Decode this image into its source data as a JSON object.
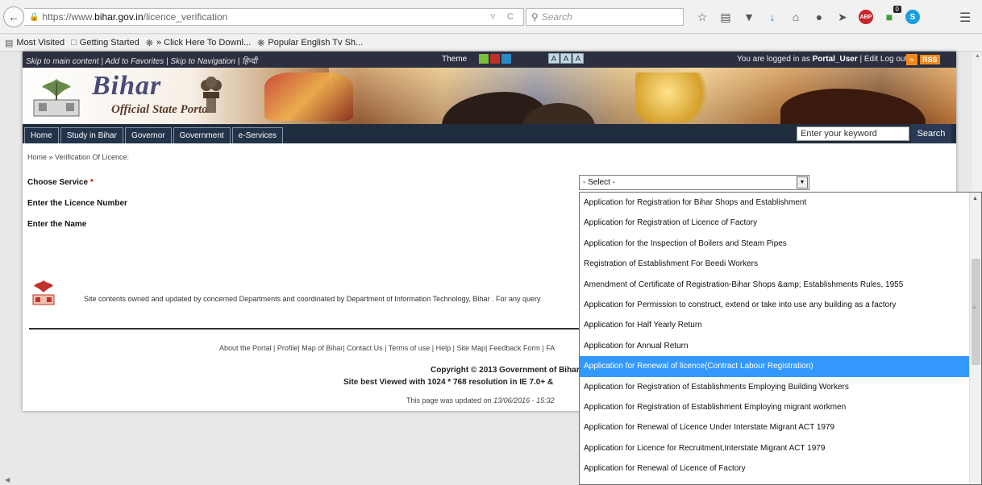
{
  "browser": {
    "url_prefix": "https://www.",
    "url_host": "bihar.gov.in",
    "url_path": "/licence_verification",
    "search_placeholder": "Search",
    "bookmarks": [
      "Most Visited",
      "Getting Started",
      "» Click Here To Downl...",
      "Popular English Tv Sh..."
    ],
    "badge_count": "0",
    "abp_label": "ABP",
    "skype_label": "S"
  },
  "topstrip": {
    "links": "Skip to main content | Add to Favorites | Skip to Navigation | हिन्दी",
    "theme_label": "Theme",
    "theme_colors": [
      "#7cbf3a",
      "#c0302a",
      "#2a8ac4"
    ],
    "font_sizes": [
      "A",
      "A",
      "A"
    ],
    "login_prefix": "You are logged in as ",
    "login_user": "Portal_User",
    "login_suffix": " | Edit  Log out",
    "rss": "RSS"
  },
  "banner": {
    "title": "Bihar",
    "subtitle": "Official State Portal"
  },
  "nav": {
    "items": [
      "Home",
      "Study in Bihar",
      "Governor",
      "Government",
      "e-Services"
    ],
    "search_placeholder": "Enter your keyword",
    "search_button": "Search"
  },
  "breadcrumb": "Home » Verification Of Licence:",
  "form": {
    "choose_service_label": "Choose Service",
    "required_mark": "*",
    "licence_number_label": "Enter the Licence Number",
    "name_label": "Enter the Name",
    "select_value": "- Select -"
  },
  "footer": {
    "owned": "Site contents owned and updated by concerned Departments and coordinated by Department of Information Technology, Bihar . For any query",
    "links": "About the Portal | Profile| Map of Bihar| Contact Us | Terms of use | Help | Site Map| Feedback Form | FA",
    "copyright": "Copyright © 2013 Government of Bihar",
    "best_viewed": "Site best Viewed with 1024 * 768 resolution in IE 7.0+ &",
    "updated_prefix": "This page was updated on ",
    "updated_date": "13/06/2016 - 15:32"
  },
  "dropdown": {
    "selected_index": 8,
    "options": [
      "Application for Registration for Bihar Shops and Establishment",
      "Application for Registration of Licence of Factory",
      "Application for the Inspection of Boilers and Steam Pipes",
      "Registration of Establishment For Beedi Workers",
      "Amendment of Certificate of Registration-Bihar Shops &amp; Establishments Rules, 1955",
      "Application for Permission to construct, extend or take into use any building as a factory",
      "Application for Half Yearly Return",
      "Application for Annual Return",
      "Application for Renewal of licence(Contract Labour Registration)",
      "Application for Registration of Establishments Employing Building Workers",
      "Application for Registration of Establishment Employing migrant workmen",
      "Application for Renewal of Licence Under Interstate Migrant ACT 1979",
      "Application for Licence for Recruitment,Interstate Migrant ACT 1979",
      "Application for Renewal of Licence of Factory"
    ]
  },
  "colors": {
    "nav_bg": "#1f2d3e",
    "topstrip_bg": "#2b2f40",
    "selected_option": "#3399ff",
    "required": "#dd0000"
  }
}
